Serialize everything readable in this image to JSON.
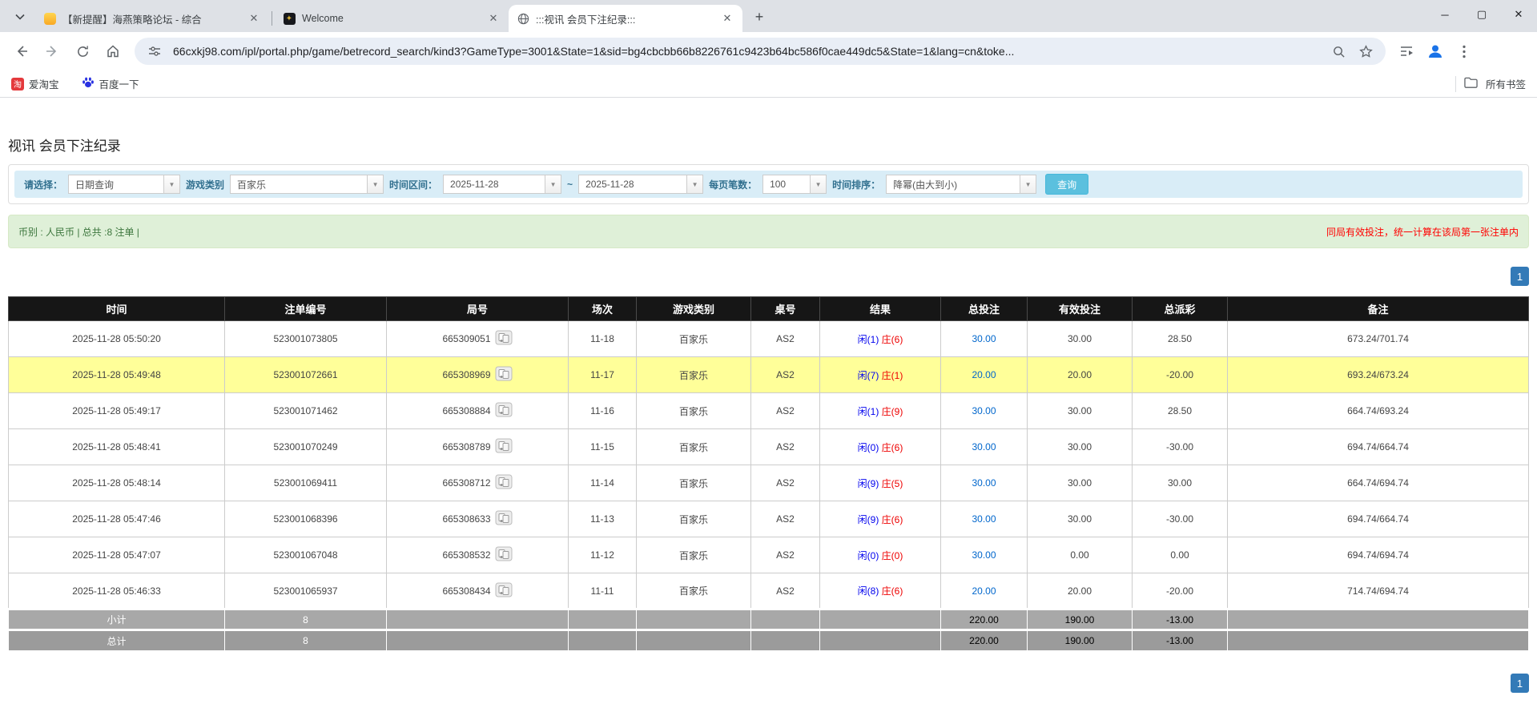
{
  "browser": {
    "tabs": [
      {
        "title": "【新提醒】海燕策略论坛 - 综合",
        "icon": "forum-yellow"
      },
      {
        "title": "Welcome",
        "icon": "casino-dark"
      },
      {
        "title": ":::视讯 会员下注纪录:::",
        "icon": "globe"
      }
    ],
    "new_tab": "+",
    "window_controls": {
      "minimize": "─",
      "maximize": "▢",
      "close": "✕"
    },
    "url": "66cxkj98.com/ipl/portal.php/game/betrecord_search/kind3?GameType=3001&State=1&sid=bg4cbcbb66b8226761c9423b64bc586f0cae449dc5&State=1&lang=cn&toke...",
    "bookmarks": [
      {
        "label": "爱淘宝",
        "icon": "taobao",
        "icon_char": "淘"
      },
      {
        "label": "百度一下",
        "icon": "baidu-paw"
      }
    ],
    "all_bookmarks_label": "所有书签"
  },
  "page": {
    "title": "视讯 会员下注纪录",
    "filters": {
      "select_label": "请选择：",
      "select_value": "日期查询",
      "game_label": "游戏类别",
      "game_value": "百家乐",
      "range_label": "时间区间：",
      "date_from": "2025-11-28",
      "range_tilde": "~",
      "date_to": "2025-11-28",
      "per_page_label": "每页笔数：",
      "per_page_value": "100",
      "sort_label": "时间排序：",
      "sort_value": "降幂(由大到小)",
      "search_button": "查询"
    },
    "summary": {
      "left": "币别 : 人民币 | 总共 :8 注单 |",
      "right_notice": "同局有效投注，统一计算在该局第一张注单内"
    },
    "pagination": {
      "page": "1"
    },
    "table": {
      "headers": [
        "时间",
        "注单编号",
        "局号",
        "场次",
        "游戏类别",
        "桌号",
        "结果",
        "总投注",
        "有效投注",
        "总派彩",
        "备注"
      ],
      "rows": [
        {
          "time": "2025-11-28 05:50:20",
          "bet_id": "523001073805",
          "round_id": "665309051",
          "session": "11-18",
          "game": "百家乐",
          "table_no": "AS2",
          "player": "闲(1)",
          "banker": "庄(6)",
          "total_bet": "30.00",
          "valid_bet": "30.00",
          "payout": "28.50",
          "note": "673.24/701.74",
          "highlight": false
        },
        {
          "time": "2025-11-28 05:49:48",
          "bet_id": "523001072661",
          "round_id": "665308969",
          "session": "11-17",
          "game": "百家乐",
          "table_no": "AS2",
          "player": "闲(7)",
          "banker": "庄(1)",
          "total_bet": "20.00",
          "valid_bet": "20.00",
          "payout": "-20.00",
          "note": "693.24/673.24",
          "highlight": true
        },
        {
          "time": "2025-11-28 05:49:17",
          "bet_id": "523001071462",
          "round_id": "665308884",
          "session": "11-16",
          "game": "百家乐",
          "table_no": "AS2",
          "player": "闲(1)",
          "banker": "庄(9)",
          "total_bet": "30.00",
          "valid_bet": "30.00",
          "payout": "28.50",
          "note": "664.74/693.24",
          "highlight": false
        },
        {
          "time": "2025-11-28 05:48:41",
          "bet_id": "523001070249",
          "round_id": "665308789",
          "session": "11-15",
          "game": "百家乐",
          "table_no": "AS2",
          "player": "闲(0)",
          "banker": "庄(6)",
          "total_bet": "30.00",
          "valid_bet": "30.00",
          "payout": "-30.00",
          "note": "694.74/664.74",
          "highlight": false
        },
        {
          "time": "2025-11-28 05:48:14",
          "bet_id": "523001069411",
          "round_id": "665308712",
          "session": "11-14",
          "game": "百家乐",
          "table_no": "AS2",
          "player": "闲(9)",
          "banker": "庄(5)",
          "total_bet": "30.00",
          "valid_bet": "30.00",
          "payout": "30.00",
          "note": "664.74/694.74",
          "highlight": false
        },
        {
          "time": "2025-11-28 05:47:46",
          "bet_id": "523001068396",
          "round_id": "665308633",
          "session": "11-13",
          "game": "百家乐",
          "table_no": "AS2",
          "player": "闲(9)",
          "banker": "庄(6)",
          "total_bet": "30.00",
          "valid_bet": "30.00",
          "payout": "-30.00",
          "note": "694.74/664.74",
          "highlight": false
        },
        {
          "time": "2025-11-28 05:47:07",
          "bet_id": "523001067048",
          "round_id": "665308532",
          "session": "11-12",
          "game": "百家乐",
          "table_no": "AS2",
          "player": "闲(0)",
          "banker": "庄(0)",
          "total_bet": "30.00",
          "valid_bet": "0.00",
          "payout": "0.00",
          "note": "694.74/694.74",
          "highlight": false
        },
        {
          "time": "2025-11-28 05:46:33",
          "bet_id": "523001065937",
          "round_id": "665308434",
          "session": "11-11",
          "game": "百家乐",
          "table_no": "AS2",
          "player": "闲(8)",
          "banker": "庄(6)",
          "total_bet": "20.00",
          "valid_bet": "20.00",
          "payout": "-20.00",
          "note": "714.74/694.74",
          "highlight": false
        }
      ],
      "subtotal": {
        "label": "小计",
        "count": "8",
        "total_bet": "220.00",
        "valid_bet": "190.00",
        "payout": "-13.00"
      },
      "grand_total": {
        "label": "总计",
        "count": "8",
        "total_bet": "220.00",
        "valid_bet": "190.00",
        "payout": "-13.00"
      }
    },
    "colors": {
      "search_button": "#5bc0de",
      "pagination": "#337ab7",
      "player_blue": "#0000ee",
      "banker_red": "#ee0000",
      "bet_link_blue": "#0066cc",
      "negative_red": "#ff0000",
      "highlight_yellow": "#ffff99",
      "filter_bar_bg": "#d9edf7",
      "summary_bar_bg": "#dff0d8",
      "table_header_bg": "#161616"
    }
  }
}
